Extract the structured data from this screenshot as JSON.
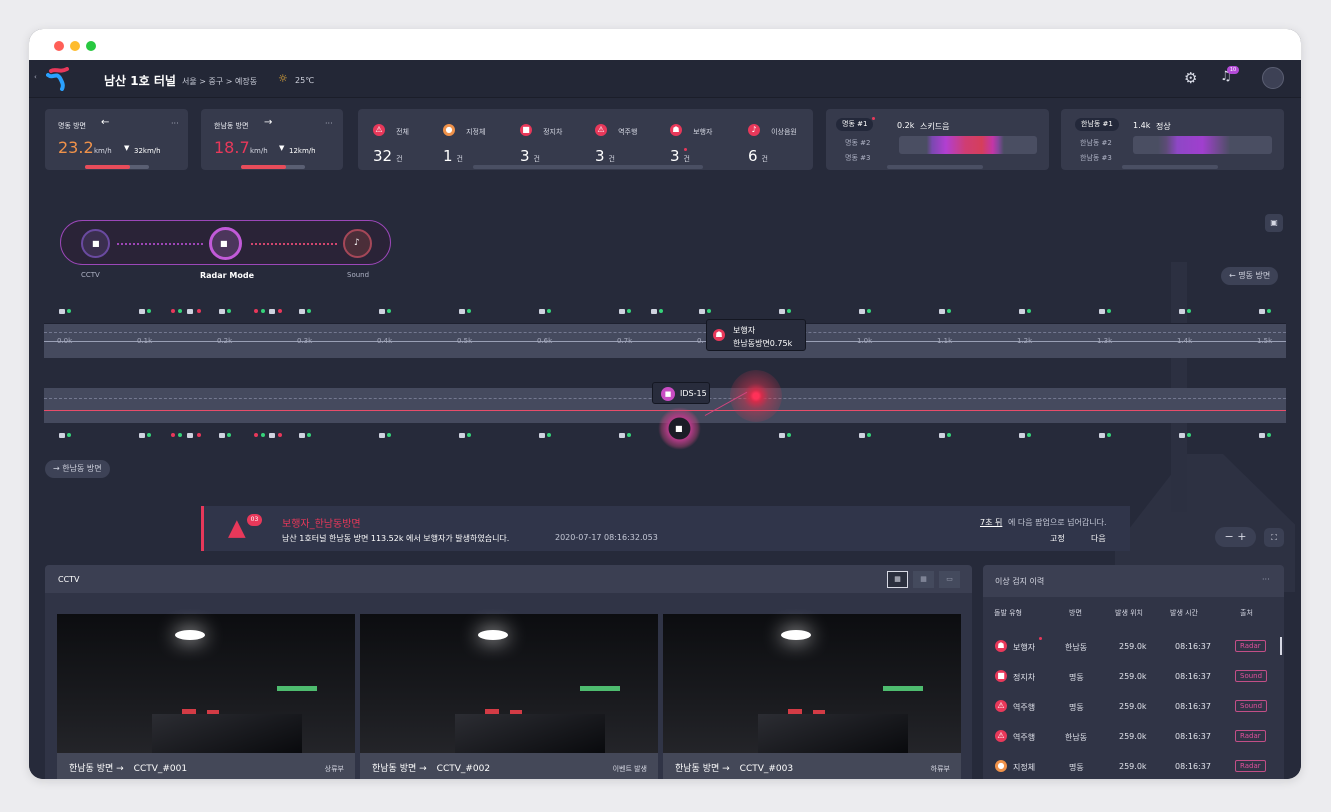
{
  "header": {
    "title": "남산 1호 터널",
    "breadcrumb": "서울 > 중구 > 예장동",
    "weather": "25℃",
    "notification_count": "10"
  },
  "directions": {
    "myeongdong": {
      "label": "명동 방면",
      "speed": "23.2",
      "speed_unit": "km/h",
      "limit": "32km/h"
    },
    "hannamdong": {
      "label": "한남동 방면",
      "speed": "18.7",
      "speed_unit": "km/h",
      "limit": "12km/h"
    }
  },
  "event_summary": [
    {
      "label": "전체",
      "count": "32",
      "unit": "건"
    },
    {
      "label": "지정체",
      "count": "1",
      "unit": "건"
    },
    {
      "label": "정지차",
      "count": "3",
      "unit": "건"
    },
    {
      "label": "역주행",
      "count": "3",
      "unit": "건"
    },
    {
      "label": "보행자",
      "count": "3",
      "unit": "건"
    },
    {
      "label": "이상음원",
      "count": "6",
      "unit": "건"
    }
  ],
  "myeong_panel": {
    "active_tab": "명동 #1",
    "tabs": [
      "명동 #2",
      "명동 #3"
    ],
    "value": "0.2k",
    "status": "스키드음"
  },
  "hannam_panel": {
    "active_tab": "한남동 #1",
    "tabs": [
      "한남동 #2",
      "한남동 #3"
    ],
    "value": "1.4k",
    "status": "정상"
  },
  "mode_switch": {
    "left": "CCTV",
    "middle": "Radar Mode",
    "right": "Sound"
  },
  "map": {
    "top_direction": "명동 방면",
    "bottom_direction": "한남동 방면",
    "scale": [
      "0.0k",
      "0.1k",
      "0.2k",
      "0.3k",
      "0.4k",
      "0.5k",
      "0.6k",
      "0.7k",
      "0.",
      "1.0k",
      "1.1k",
      "1.2k",
      "1.3k",
      "1.4k",
      "1.5k"
    ],
    "device_label": "IDS-15",
    "event_title": "보행자",
    "event_detail": "한남동방면0.75k"
  },
  "alert": {
    "badge": "03",
    "title": "보행자_한남동방면",
    "message": "남산 1호터널 한남동 방면 113.52k 에서 보행자가 발생하였습니다.",
    "timestamp": "2020-07-17 08:16:32.053",
    "countdown_link": "7초 뒤",
    "countdown_text": "에 다음 팝업으로 넘어갑니다.",
    "fix": "고정",
    "next": "다음"
  },
  "cctv": {
    "title": "CCTV",
    "cards": [
      {
        "direction": "한남동 방면 →",
        "camera": "CCTV_#001",
        "tag": "상류부"
      },
      {
        "direction": "한남동 방면 →",
        "camera": "CCTV_#002",
        "tag": "이벤트 발생"
      },
      {
        "direction": "한남동 방면 →",
        "camera": "CCTV_#003",
        "tag": "하류부"
      }
    ]
  },
  "history": {
    "title": "이상 검지 이력",
    "headers": [
      "돌발 유형",
      "방면",
      "발생 위치",
      "발생 시간",
      "출처"
    ],
    "rows": [
      {
        "type": "보행자",
        "direction": "한남동",
        "position": "259.0k",
        "time": "08:16:37",
        "source": "Radar"
      },
      {
        "type": "정지차",
        "direction": "명동",
        "position": "259.0k",
        "time": "08:16:37",
        "source": "Sound"
      },
      {
        "type": "역주행",
        "direction": "명동",
        "position": "259.0k",
        "time": "08:16:37",
        "source": "Sound"
      },
      {
        "type": "역주행",
        "direction": "한남동",
        "position": "259.0k",
        "time": "08:16:37",
        "source": "Radar"
      },
      {
        "type": "지정체",
        "direction": "명동",
        "position": "259.0k",
        "time": "08:16:37",
        "source": "Radar"
      }
    ]
  },
  "colors": {
    "accent": "#e8385a",
    "speed_orange": "#f0924a",
    "panel": "#363a4c",
    "radar_purple": "#a04ad6",
    "ok": "#36d37a"
  }
}
